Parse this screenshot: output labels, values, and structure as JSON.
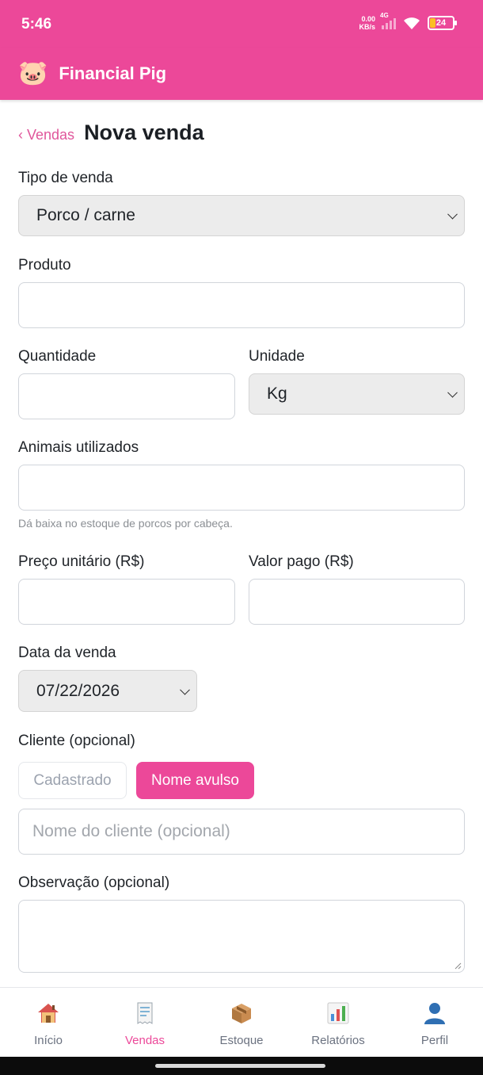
{
  "status_bar": {
    "time": "5:46",
    "net_speed_value": "0.00",
    "net_speed_unit": "KB/s",
    "network_type": "4G",
    "battery": "24"
  },
  "app_bar": {
    "logo_icon": "pig-face-icon",
    "title": "Financial Pig"
  },
  "breadcrumb": {
    "back_label": "‹ Vendas",
    "title": "Nova venda"
  },
  "form": {
    "tipo_venda": {
      "label": "Tipo de venda",
      "value": "Porco / carne"
    },
    "produto": {
      "label": "Produto",
      "value": ""
    },
    "quantidade": {
      "label": "Quantidade",
      "value": ""
    },
    "unidade": {
      "label": "Unidade",
      "value": "Kg"
    },
    "animais": {
      "label": "Animais utilizados",
      "value": "",
      "hint": "Dá baixa no estoque de porcos por cabeça."
    },
    "preco_unitario": {
      "label": "Preço unitário (R$)",
      "value": ""
    },
    "valor_pago": {
      "label": "Valor pago (R$)",
      "value": ""
    },
    "data_venda": {
      "label": "Data da venda",
      "value": "07/22/2026"
    },
    "cliente": {
      "label": "Cliente (opcional)",
      "option_registered": "Cadastrado",
      "option_loose": "Nome avulso",
      "selected": "Nome avulso",
      "name_placeholder": "Nome do cliente (opcional)"
    },
    "observacao": {
      "label": "Observação (opcional)",
      "value": ""
    }
  },
  "bottom_nav": {
    "items": [
      {
        "label": "Início",
        "icon": "house-icon",
        "active": false
      },
      {
        "label": "Vendas",
        "icon": "receipt-icon",
        "active": true
      },
      {
        "label": "Estoque",
        "icon": "package-icon",
        "active": false
      },
      {
        "label": "Relatórios",
        "icon": "bar-chart-icon",
        "active": false
      },
      {
        "label": "Perfil",
        "icon": "user-icon",
        "active": false
      }
    ]
  },
  "colors": {
    "brand": "#ec4899",
    "input_border": "#d1d5db",
    "select_bg": "#ececec"
  }
}
